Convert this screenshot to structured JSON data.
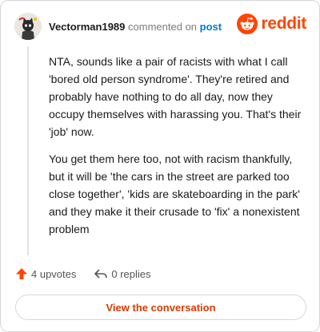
{
  "header": {
    "username": "Vectorman1989",
    "action_text": "commented on",
    "post_link_text": "post"
  },
  "brand": {
    "wordmark": "reddit",
    "logo_icon": "reddit-snoo-icon",
    "color": "#ff4500"
  },
  "comment": {
    "paragraphs": [
      "NTA, sounds like a pair of racists with what I call 'bored old person syndrome'. They're retired and probably have nothing to do all day, now they occupy themselves with harassing you. That's their 'job' now.",
      "You get them here too, not with racism thankfully, but it will be 'the cars in the street are parked too close together', 'kids are skateboarding in the park' and they make it their crusade to 'fix' a nonexistent problem"
    ]
  },
  "actions": {
    "upvotes_label": "4 upvotes",
    "upvote_icon": "upvote-arrow-icon",
    "upvote_color": "#ff4500",
    "replies_label": "0 replies",
    "reply_icon": "reply-arrow-icon"
  },
  "footer": {
    "view_button_label": "View the conversation",
    "accent_color": "#d93a00"
  }
}
